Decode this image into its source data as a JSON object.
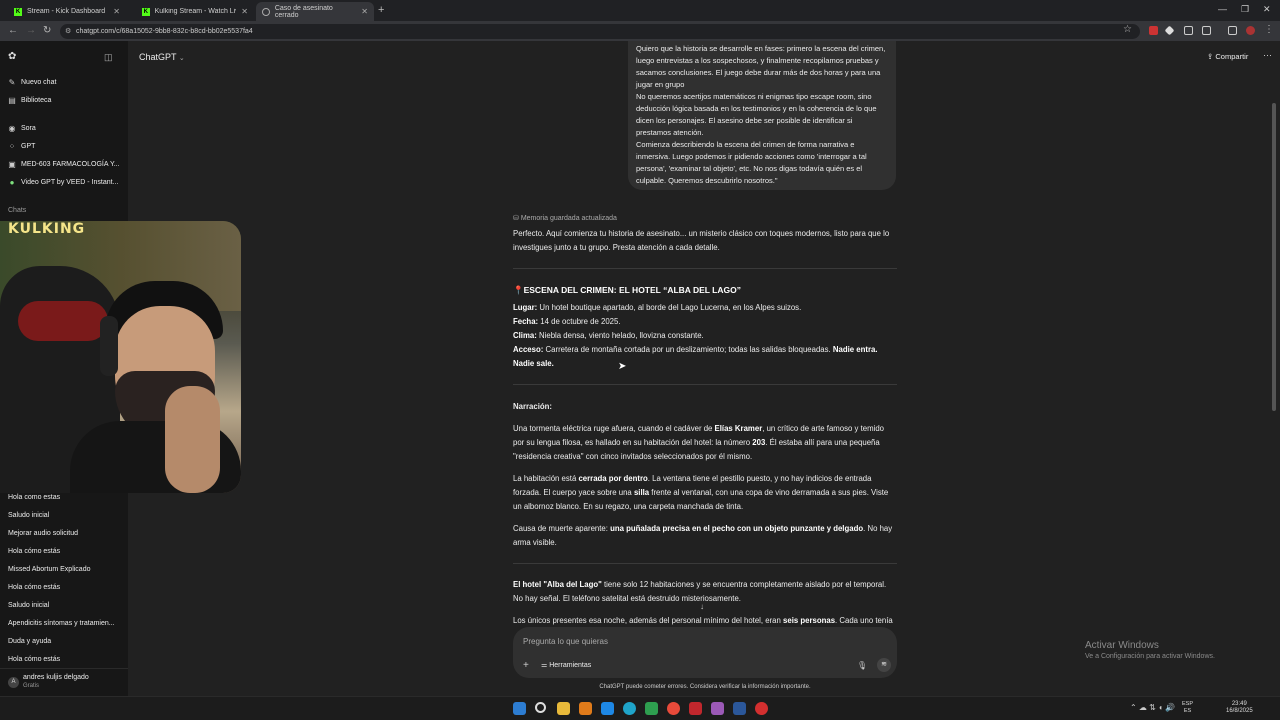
{
  "browser": {
    "tabs": [
      {
        "label": "Stream - Kick Dashboard"
      },
      {
        "label": "Kulking Stream - Watch Live o..."
      },
      {
        "label": "Caso de asesinato cerrado"
      }
    ],
    "url": "chatgpt.com/c/68a15052-9bb8-832c-b8cd-bb02e5537fa4"
  },
  "sidebar": {
    "top_items": [
      {
        "label": "Nuevo chat",
        "icon": "edit-icon"
      },
      {
        "label": "Biblioteca",
        "icon": "library-icon"
      },
      {
        "label": "Sora",
        "icon": "sora-icon"
      },
      {
        "label": "GPT",
        "icon": "gpt-icon"
      },
      {
        "label": "MED-603 FARMACOLOGÍA Y...",
        "icon": "custom-gpt-icon"
      },
      {
        "label": "Video GPT by VEED - Instant...",
        "icon": "veed-icon"
      }
    ],
    "chats_label": "Chats",
    "chats": [
      "Hola como estas",
      "Saludo inicial",
      "Mejorar audio solicitud",
      "Hola cómo estás",
      "Missed Abortum Explicado",
      "Hola cómo estás",
      "Saludo inicial",
      "Apendicitis síntomas y tratamien...",
      "Duda y ayuda",
      "Hola cómo estás"
    ],
    "user": {
      "name": "andres kuljis delgado",
      "plan": "Gratis",
      "initial": "A"
    }
  },
  "webcam": {
    "sign": "KULKING"
  },
  "header": {
    "model": "ChatGPT",
    "share_label": "Compartir"
  },
  "conversation": {
    "user_message": [
      "Quiero que la historia se desarrolle en fases: primero la escena del crimen, luego entrevistas a los sospechosos, y finalmente recopilamos pruebas y sacamos conclusiones. El juego debe durar más de dos horas y para una jugar en grupo",
      "No queremos acertijos matemáticos ni enigmas tipo escape room, sino deducción lógica basada en los testimonios y en la coherencia de lo que dicen los personajes. El asesino debe ser posible de identificar si prestamos atención.",
      "Comienza describiendo la escena del crimen de forma narrativa e inmersiva. Luego podemos ir pidiendo acciones como 'interrogar a tal persona', 'examinar tal objeto', etc. No nos digas todavía quién es el culpable. Queremos descubrirlo nosotros.\""
    ],
    "memory_note": "Memoria guardada actualizada",
    "intro": "Perfecto. Aquí comienza tu historia de asesinato... un misterio clásico con toques modernos, listo para que lo investigues junto a tu grupo. Presta atención a cada detalle.",
    "scene_heading": "ESCENA DEL CRIMEN: EL HOTEL “ALBA DEL LAGO”",
    "facts": [
      {
        "label": "Lugar:",
        "value": " Un hotel boutique apartado, al borde del Lago Lucerna, en los Alpes suizos."
      },
      {
        "label": "Fecha:",
        "value": " 14 de octubre de 2025."
      },
      {
        "label": "Clima:",
        "value": " Niebla densa, viento helado, llovizna constante."
      },
      {
        "label": "Acceso:",
        "value": " Carretera de montaña cortada por un deslizamiento; todas las salidas bloqueadas. ",
        "bold_tail": "Nadie entra. Nadie sale."
      }
    ],
    "narration_label": "Narración:",
    "narr1": {
      "a": "Una tormenta eléctrica ruge afuera, cuando el cadáver de ",
      "b": "Elías Kramer",
      "c": ", un crítico de arte famoso y temido por su lengua filosa, es hallado en su habitación del hotel: la número ",
      "d": "203",
      "e": ". Él estaba allí para una pequeña \"residencia creativa\" con cinco invitados seleccionados por él mismo."
    },
    "narr2": {
      "a": "La habitación está ",
      "b": "cerrada por dentro",
      "c": ". La ventana tiene el pestillo puesto, y no hay indicios de entrada forzada. El cuerpo yace sobre una ",
      "d": "silla",
      "e": " frente al ventanal, con una copa de vino derramada a sus pies. Viste un albornoz blanco. En su regazo, una carpeta manchada de tinta."
    },
    "narr3": {
      "a": "Causa de muerte aparente: ",
      "b": "una puñalada precisa en el pecho con un objeto punzante y delgado",
      "c": ". No hay arma visible."
    },
    "narr4": {
      "a": "El hotel \"Alba del Lago\"",
      "b": " tiene solo 12 habitaciones y se encuentra completamente aislado por el temporal. No hay señal. El teléfono satelital está destruido misteriosamente."
    },
    "narr5": {
      "a": "Los únicos presentes esa noche, además del personal mínimo del hotel, eran ",
      "b": "seis personas",
      "c": ". Cada uno tenía"
    }
  },
  "composer": {
    "placeholder": "Pregunta lo que quieras",
    "tools_label": "Herramientas"
  },
  "disclaimer": "ChatGPT puede cometer errores. Considera verificar la información importante.",
  "windows": {
    "activate_title": "Activar Windows",
    "activate_sub": "Ve a Configuración para activar Windows.",
    "lang": "ESP",
    "lang_region": "ES",
    "time": "23:49",
    "date": "16/8/2025"
  },
  "colors": {
    "background": "#212121",
    "sidebar": "#171717",
    "bubble": "#303030",
    "kick_green": "#53fc18"
  }
}
